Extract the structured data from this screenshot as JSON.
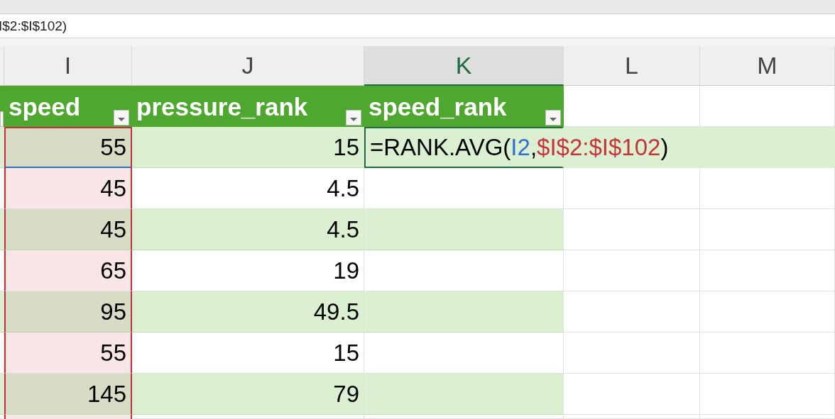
{
  "formula_bar": {
    "text": "I$2:$I$102)"
  },
  "columns": [
    {
      "letter": "I",
      "selected": false,
      "referenced": true,
      "header": "speed"
    },
    {
      "letter": "J",
      "selected": false,
      "referenced": false,
      "header": "pressure_rank"
    },
    {
      "letter": "K",
      "selected": true,
      "referenced": false,
      "header": "speed_rank"
    },
    {
      "letter": "L",
      "selected": false,
      "referenced": false
    },
    {
      "letter": "M",
      "selected": false,
      "referenced": false
    }
  ],
  "rows": [
    {
      "cells": [
        "55",
        "15"
      ],
      "editing": true,
      "formula": [
        {
          "text": "=RANK.AVG(",
          "color": "#000000"
        },
        {
          "text": "I2",
          "color": "#2f6fd0"
        },
        {
          "text": ",",
          "color": "#000000"
        },
        {
          "text": "$I$2:$I$102",
          "color": "#c8323c"
        },
        {
          "text": ")",
          "color": "#000000"
        }
      ]
    },
    {
      "cells": [
        "45",
        "4.5"
      ],
      "editing": false
    },
    {
      "cells": [
        "45",
        "4.5"
      ],
      "editing": false
    },
    {
      "cells": [
        "65",
        "19"
      ],
      "editing": false
    },
    {
      "cells": [
        "95",
        "49.5"
      ],
      "editing": false
    },
    {
      "cells": [
        "55",
        "15"
      ],
      "editing": false
    },
    {
      "cells": [
        "145",
        "79"
      ],
      "editing": false
    }
  ]
}
